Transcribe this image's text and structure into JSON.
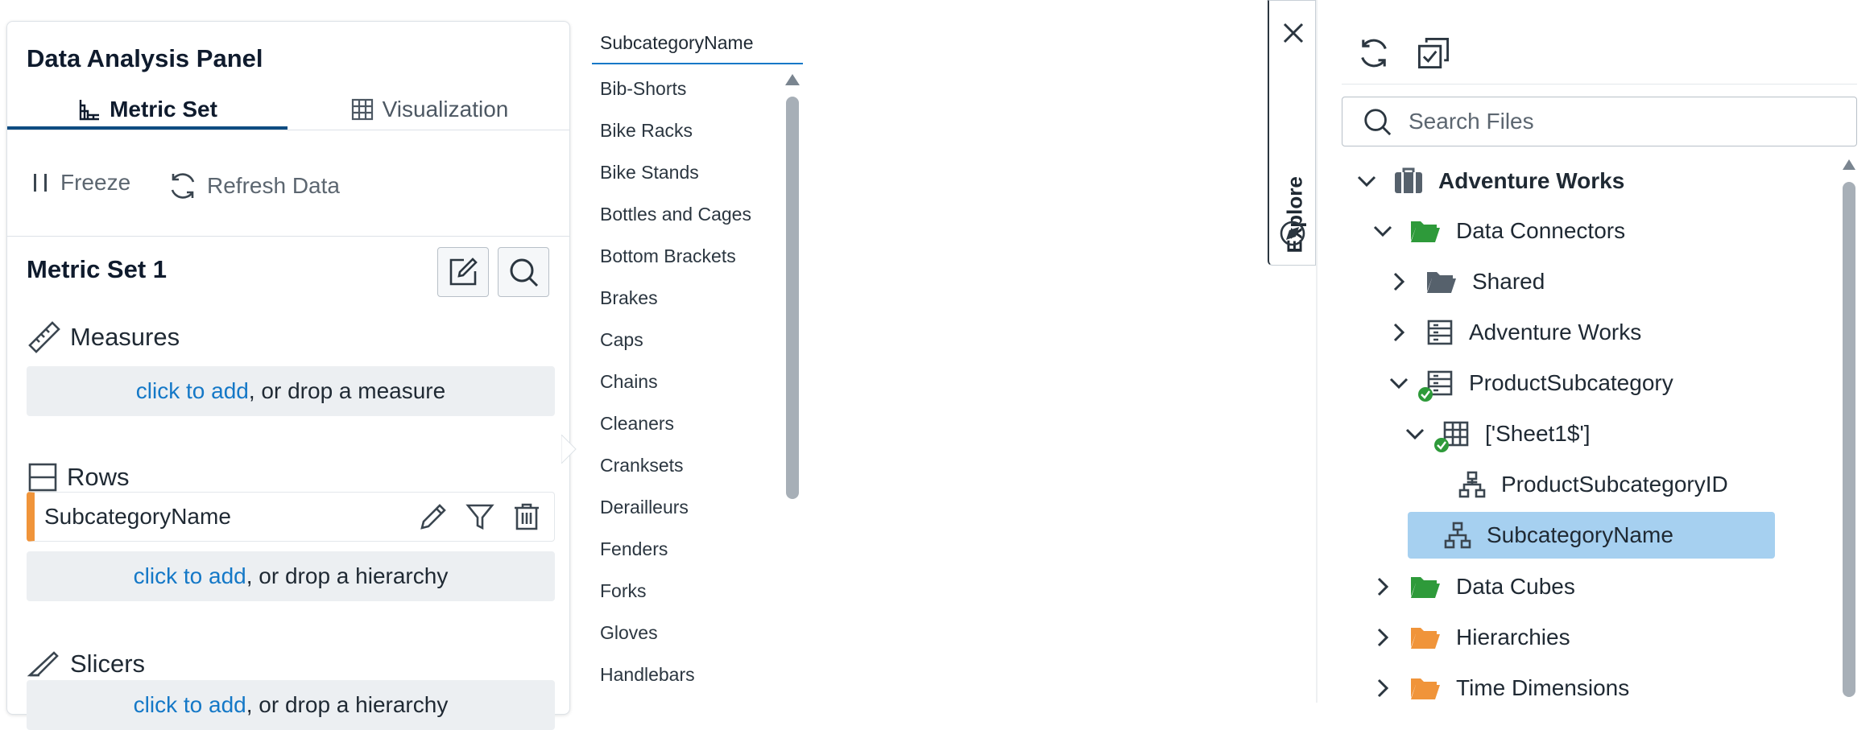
{
  "left_panel": {
    "title": "Data Analysis Panel",
    "tabs": [
      {
        "label": "Metric Set",
        "icon": "metric-set-icon",
        "active": true
      },
      {
        "label": "Visualization",
        "icon": "grid-icon",
        "active": false
      }
    ],
    "toolbar": {
      "freeze_label": "Freeze",
      "refresh_label": "Refresh Data"
    },
    "metric_set": {
      "title": "Metric Set 1",
      "measures": {
        "heading": "Measures",
        "drop_link": "click to add",
        "drop_text": ", or drop a measure"
      },
      "rows": {
        "heading": "Rows",
        "field": "SubcategoryName",
        "drop_link": "click to add",
        "drop_text": ", or drop a hierarchy"
      },
      "slicers": {
        "heading": "Slicers",
        "drop_link": "click to add",
        "drop_text": ", or drop a hierarchy"
      }
    },
    "accent_color": "#f0943a"
  },
  "value_list": {
    "header": "SubcategoryName",
    "items": [
      "Bib-Shorts",
      "Bike Racks",
      "Bike Stands",
      "Bottles and Cages",
      "Bottom Brackets",
      "Brakes",
      "Caps",
      "Chains",
      "Cleaners",
      "Cranksets",
      "Derailleurs",
      "Fenders",
      "Forks",
      "Gloves",
      "Handlebars"
    ]
  },
  "explore": {
    "label": "Explore"
  },
  "file_tree": {
    "search_placeholder": "Search Files",
    "nodes": [
      {
        "label": "Adventure Works",
        "icon": "briefcase-icon",
        "expanded": true,
        "bold": true
      },
      {
        "label": "Data Connectors",
        "icon": "folder-open-icon",
        "expanded": true
      },
      {
        "label": "Shared",
        "icon": "folder-icon",
        "expanded": false
      },
      {
        "label": "Adventure Works",
        "icon": "data-connector-icon",
        "expanded": false
      },
      {
        "label": "ProductSubcategory",
        "icon": "data-connector-icon",
        "expanded": true,
        "status": "ok"
      },
      {
        "label": "['Sheet1$']",
        "icon": "table-icon",
        "expanded": true,
        "status": "ok"
      },
      {
        "label": "ProductSubcategoryID",
        "icon": "hierarchy-icon"
      },
      {
        "label": "SubcategoryName",
        "icon": "hierarchy-icon",
        "selected": true
      },
      {
        "label": "Data Cubes",
        "icon": "folder-open-icon",
        "expanded": false
      },
      {
        "label": "Hierarchies",
        "icon": "folder-open-icon",
        "expanded": false
      },
      {
        "label": "Time Dimensions",
        "icon": "folder-open-icon",
        "expanded": false
      }
    ],
    "selected_color": "#a6d0f0",
    "folder_green": "#2e9a3a",
    "folder_orange": "#f0943a"
  }
}
